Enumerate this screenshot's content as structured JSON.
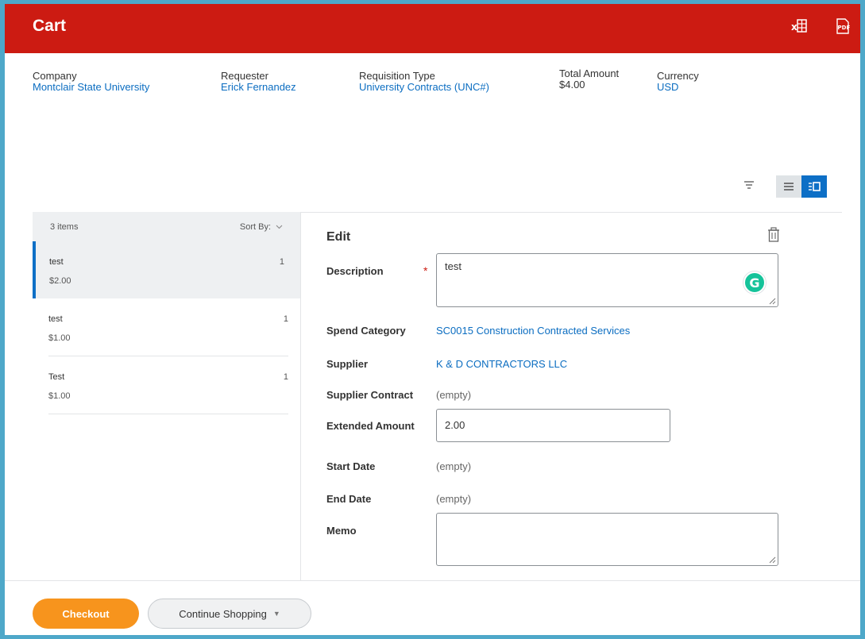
{
  "topbar": {
    "title": "Cart",
    "export_excel_icon": "excel-export-icon",
    "export_pdf_icon": "pdf-export-icon"
  },
  "header": {
    "company_label": "Company",
    "company_value": "Montclair State University",
    "requester_label": "Requester",
    "requester_value": "Erick Fernandez",
    "requisition_type_label": "Requisition Type",
    "requisition_type_value": "University Contracts (UNC#)",
    "total_amount_label": "Total Amount",
    "total_amount_value": "$4.00",
    "currency_label": "Currency",
    "currency_value": "USD"
  },
  "list": {
    "count": "3 items",
    "sort_label": "Sort By:",
    "items": [
      {
        "name": "test",
        "price": "$2.00",
        "qty": "1"
      },
      {
        "name": "test",
        "price": "$1.00",
        "qty": "1"
      },
      {
        "name": "Test",
        "price": "$1.00",
        "qty": "1"
      }
    ]
  },
  "edit": {
    "title": "Edit",
    "description_label": "Description",
    "description_value": "test",
    "spend_category_label": "Spend Category",
    "spend_category_value": "SC0015 Construction Contracted Services",
    "supplier_label": "Supplier",
    "supplier_value": "K & D CONTRACTORS LLC",
    "supplier_contract_label": "Supplier Contract",
    "supplier_contract_value": "(empty)",
    "extended_amount_label": "Extended Amount",
    "extended_amount_value": "2.00",
    "start_date_label": "Start Date",
    "start_date_value": "(empty)",
    "end_date_label": "End Date",
    "end_date_value": "(empty)",
    "memo_label": "Memo",
    "memo_value": ""
  },
  "footer": {
    "checkout_label": "Checkout",
    "continue_label": "Continue Shopping"
  },
  "colors": {
    "header_red": "#cc1b12",
    "link_blue": "#0b6dc1",
    "checkout_orange": "#f7941d",
    "selected_blue": "#0d6fc6"
  }
}
